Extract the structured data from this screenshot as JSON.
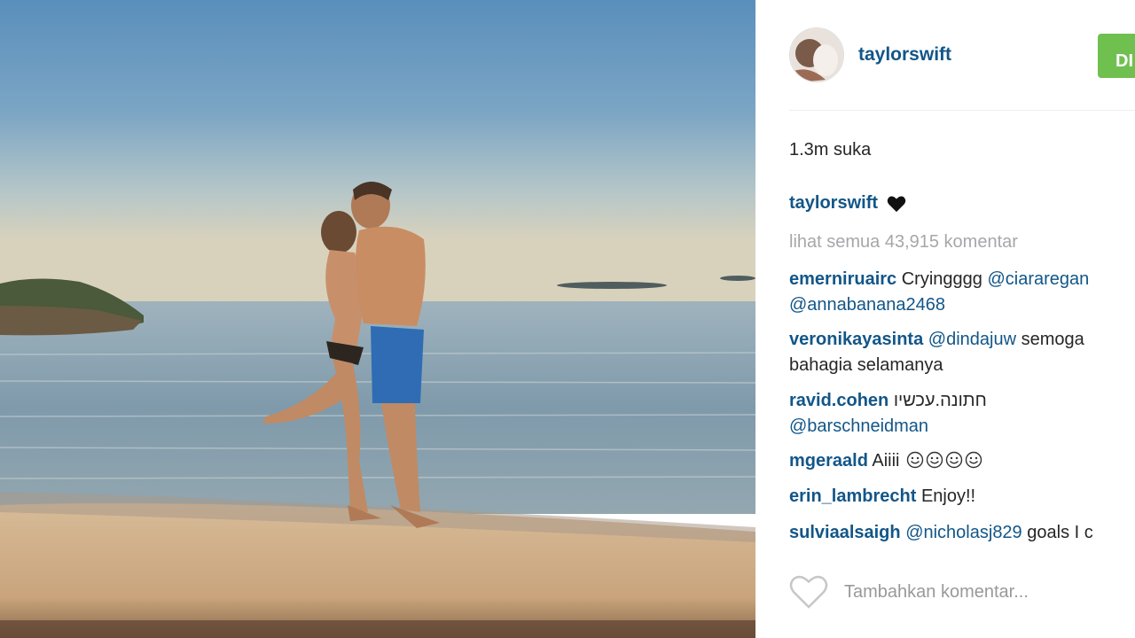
{
  "post": {
    "author": "taylorswift",
    "follow_label": "DI",
    "likes_text": "1.3m suka",
    "caption": {
      "user": "taylorswift",
      "icon": "black-heart-icon"
    },
    "view_all_comments": "lihat semua 43,915 komentar",
    "comments": [
      {
        "user": "emerniruairc",
        "text": "Cryingggg",
        "mention": "@ciararegan",
        "line2_mention": "@annabanana2468"
      },
      {
        "user": "veronikayasinta",
        "mention": "@dindajuw",
        "text": "semoga",
        "line2": "bahagia selamanya"
      },
      {
        "user": "ravid.cohen",
        "text": "חתונה.עכשיו",
        "line2_mention": "@barschneidman"
      },
      {
        "user": "mgeraald",
        "text": "Aiiii"
      },
      {
        "user": "erin_lambrecht",
        "text": "Enjoy!!"
      },
      {
        "user": "sulviaalsaigh",
        "mention": "@nicholasj829",
        "text": "goals I c"
      }
    ],
    "add_comment_placeholder": "Tambahkan komentar..."
  },
  "colors": {
    "username_blue": "#125688",
    "follow_green": "#70c050",
    "muted_gray": "#a5a7aa"
  }
}
